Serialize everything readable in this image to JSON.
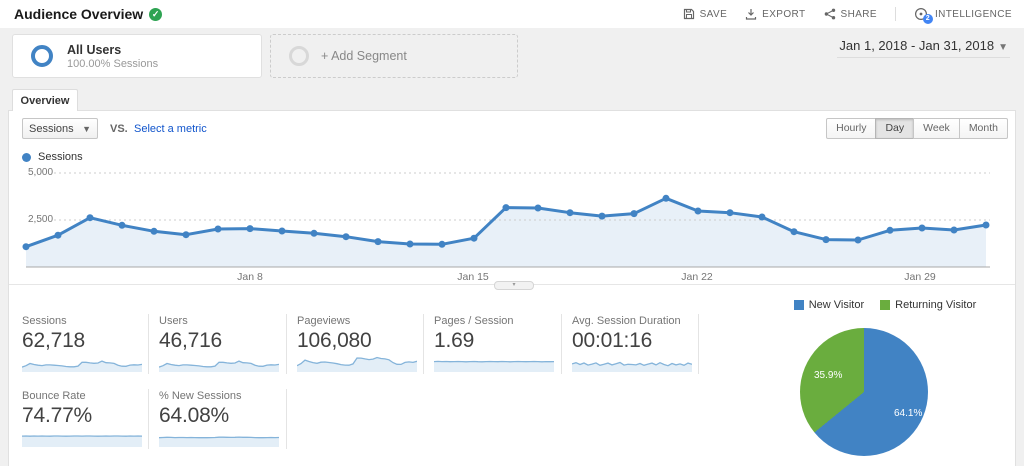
{
  "colors": {
    "chart_blue": "#4183c4",
    "chart_fill": "#e8f0f8",
    "pie_green": "#6aad3e",
    "spark_line": "#85b4da",
    "spark_fill": "#e3eef7",
    "link_blue": "#1155cc",
    "badge_green": "#2ea352"
  },
  "header": {
    "title": "Audience Overview",
    "actions": {
      "save": "SAVE",
      "export": "EXPORT",
      "share": "SHARE",
      "intelligence": "INTELLIGENCE"
    },
    "intelligence_badge": "2"
  },
  "segments": {
    "all_users_title": "All Users",
    "all_users_subtitle": "100.00% Sessions",
    "add_segment": "+ Add Segment"
  },
  "date_range": {
    "label": "Jan 1, 2018 - Jan 31, 2018"
  },
  "tabs": {
    "overview": "Overview"
  },
  "controls": {
    "metric": "Sessions",
    "vs": "vs.",
    "compare": "Select a metric",
    "granularity": [
      "Hourly",
      "Day",
      "Week",
      "Month"
    ],
    "granularity_selected": "Day"
  },
  "chart_legend": "Sessions",
  "chart_data": [
    {
      "type": "area-line",
      "name": "Sessions",
      "x_unit": "day",
      "x_start": "Jan 1, 2018",
      "x_end": "Jan 31, 2018",
      "x_ticks": [
        "Jan 8",
        "Jan 15",
        "Jan 22",
        "Jan 29"
      ],
      "ylim": [
        0,
        5000
      ],
      "ytick_labels": {
        "top": "5,000",
        "mid": "2,500"
      },
      "values": [
        1080,
        1690,
        2620,
        2220,
        1900,
        1720,
        2020,
        2040,
        1915,
        1790,
        1610,
        1350,
        1225,
        1205,
        1530,
        3160,
        3140,
        2890,
        2710,
        2840,
        3655,
        2980,
        2890,
        2660,
        1880,
        1460,
        1435,
        1950,
        2075,
        1970,
        2235
      ]
    },
    {
      "type": "pie",
      "labels": [
        "New Visitor",
        "Returning Visitor"
      ],
      "values": [
        64.1,
        35.9
      ],
      "value_labels": [
        "64.1%",
        "35.9%"
      ],
      "colors": [
        "#4183c4",
        "#6aad3e"
      ],
      "legend_position": "top"
    }
  ],
  "cards": [
    {
      "label": "Sessions",
      "value": "62,718",
      "spark": {
        "lo": -800,
        "hi": 5200,
        "values": [
          1080,
          1690,
          2620,
          2220,
          1900,
          1720,
          2020,
          2040,
          1915,
          1790,
          1610,
          1350,
          1225,
          1205,
          1530,
          3160,
          3140,
          2890,
          2710,
          2840,
          3655,
          2980,
          2890,
          2660,
          1880,
          1460,
          1435,
          1950,
          2075,
          1970,
          2235
        ]
      }
    },
    {
      "label": "Users",
      "value": "46,716",
      "spark": {
        "lo": -800,
        "hi": 5200,
        "values": [
          1080,
          1690,
          2620,
          2220,
          1900,
          1720,
          2020,
          2040,
          1915,
          1790,
          1610,
          1350,
          1225,
          1205,
          1530,
          3160,
          3140,
          2890,
          2710,
          2840,
          3655,
          2980,
          2890,
          2660,
          1880,
          1460,
          1435,
          1950,
          2075,
          1970,
          2235
        ]
      }
    },
    {
      "label": "Pageviews",
      "value": "106,080",
      "spark": {
        "lo": -800,
        "hi": 5200,
        "values": [
          1700,
          2600,
          4100,
          3500,
          3000,
          2700,
          3200,
          3250,
          3050,
          2850,
          2550,
          2150,
          1950,
          1900,
          2450,
          5000,
          4950,
          4600,
          4300,
          4500,
          5200,
          4750,
          4600,
          4200,
          3000,
          2300,
          2250,
          3100,
          3300,
          3100,
          3550
        ]
      }
    },
    {
      "label": "Pages / Session",
      "value": "1.69",
      "spark": {
        "lo": 0,
        "hi": 2.4,
        "values": [
          1.7,
          1.73,
          1.69,
          1.71,
          1.68,
          1.7,
          1.72,
          1.69,
          1.67,
          1.7,
          1.71,
          1.68,
          1.66,
          1.69,
          1.72,
          1.7,
          1.68,
          1.71,
          1.69,
          1.67,
          1.7,
          1.72,
          1.69,
          1.68,
          1.7,
          1.71,
          1.69,
          1.67,
          1.7,
          1.68,
          1.69
        ]
      }
    },
    {
      "label": "Avg. Session Duration",
      "value": "00:01:16",
      "spark": {
        "lo": 0,
        "hi": 140,
        "values": [
          76,
          88,
          70,
          85,
          64,
          74,
          86,
          62,
          72,
          84,
          66,
          78,
          90,
          64,
          72,
          70,
          66,
          80,
          62,
          74,
          84,
          66,
          88,
          70,
          58,
          80,
          66,
          76,
          62,
          84,
          72
        ]
      }
    },
    {
      "label": "Bounce Rate",
      "value": "74.77%",
      "spark": {
        "lo": 0,
        "hi": 100,
        "values": [
          74.5,
          75.2,
          73.8,
          74.9,
          74.2,
          75.0,
          74.6,
          73.9,
          74.8,
          75.1,
          74.3,
          73.7,
          74.5,
          75.0,
          74.7,
          74.1,
          74.9,
          75.2,
          74.4,
          73.8,
          74.6,
          75.0,
          74.2,
          74.8,
          75.1,
          74.5,
          73.9,
          74.7,
          74.3,
          74.9,
          74.6
        ]
      }
    },
    {
      "label": "% New Sessions",
      "value": "64.08%",
      "spark": {
        "lo": 0,
        "hi": 100,
        "values": [
          63.0,
          64.0,
          66.0,
          65.0,
          63.5,
          64.0,
          64.5,
          63.8,
          64.2,
          63.6,
          63.2,
          62.8,
          63.0,
          63.4,
          64.0,
          66.5,
          66.2,
          65.8,
          65.2,
          65.6,
          67.0,
          65.9,
          65.5,
          65.0,
          63.8,
          63.2,
          63.0,
          63.9,
          64.2,
          63.8,
          64.3
        ]
      }
    }
  ],
  "pie": {
    "legend": [
      "New Visitor",
      "Returning Visitor"
    ],
    "value_labels": [
      "64.1%",
      "35.9%"
    ]
  }
}
